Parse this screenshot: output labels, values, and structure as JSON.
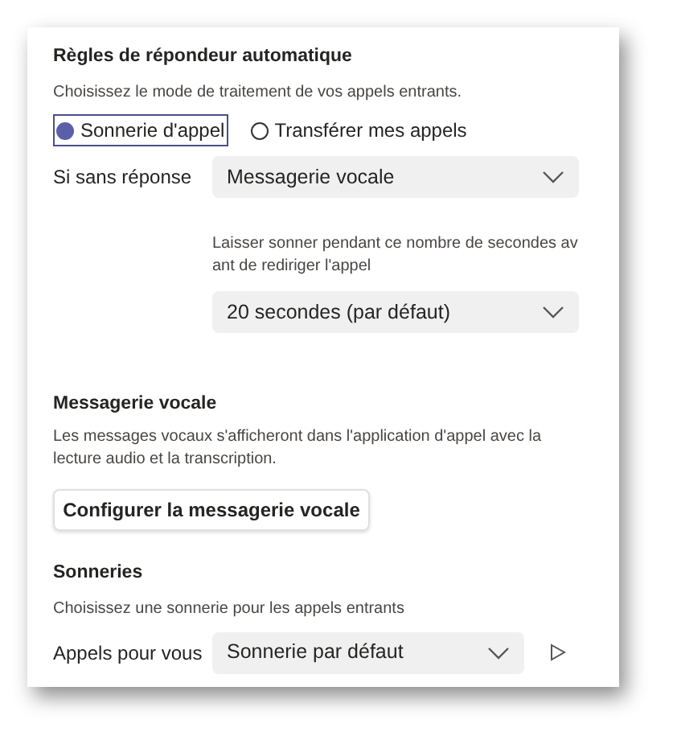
{
  "auto_answer": {
    "title": "Règles de répondeur automatique",
    "description": "Choisissez le mode de traitement de vos appels entrants.",
    "options": [
      {
        "label": "Sonnerie d'appel",
        "selected": true
      },
      {
        "label": "Transférer mes appels",
        "selected": false
      }
    ],
    "unanswered": {
      "label": "Si sans réponse",
      "value": "Messagerie vocale"
    },
    "ring_hint": "Laisser sonner pendant ce nombre de secondes avant de rediriger l'appel",
    "ring_duration": {
      "value": "20 secondes (par défaut)"
    }
  },
  "voicemail": {
    "title": "Messagerie vocale",
    "description": "Les messages vocaux s'afficheront dans l'application d'appel avec la lecture audio et la transcription.",
    "button": "Configurer la messagerie vocale"
  },
  "ringtones": {
    "title": "Sonneries",
    "description": "Choisissez une sonnerie pour les appels entrants",
    "calls_for_you": {
      "label": "Appels pour vous",
      "value": "Sonnerie par défaut"
    }
  }
}
